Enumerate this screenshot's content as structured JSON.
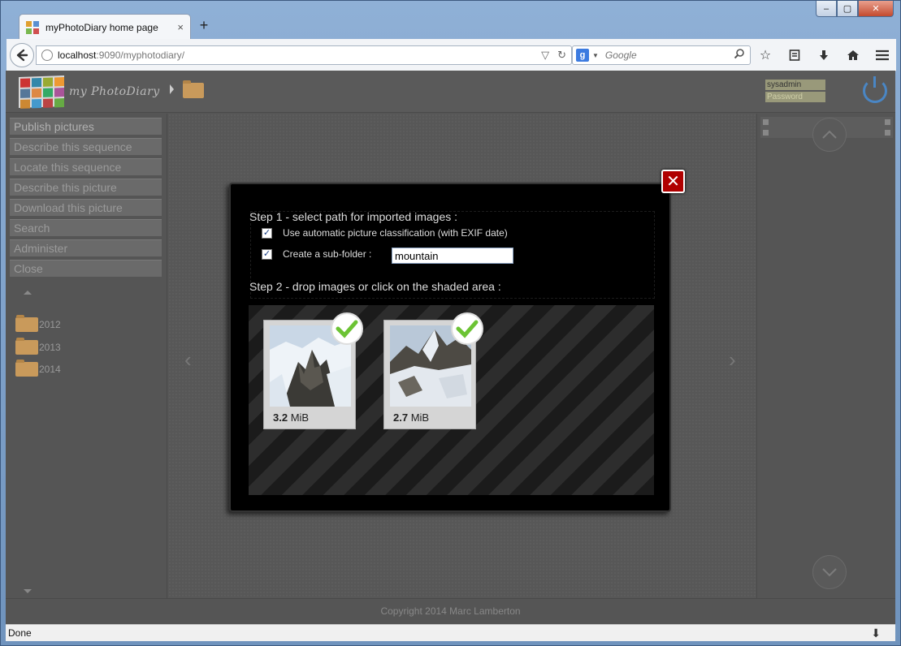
{
  "browser": {
    "tab_title": "myPhotoDiary home page",
    "tab_close": "×",
    "new_tab": "+",
    "url_host": "localhost",
    "url_path": ":9090/myphotodiary/",
    "search_engine_letter": "g",
    "search_placeholder": "Google",
    "status_text": "Done"
  },
  "app": {
    "logo_text": "my PhotoDiary",
    "login": {
      "username": "sysadmin",
      "password_placeholder": "Password"
    },
    "menu": [
      {
        "label": "Publish pictures"
      },
      {
        "label": "Describe this sequence"
      },
      {
        "label": "Locate this sequence"
      },
      {
        "label": "Describe this picture"
      },
      {
        "label": "Download this picture"
      },
      {
        "label": "Search"
      },
      {
        "label": "Administer"
      },
      {
        "label": "Close"
      }
    ],
    "tree": [
      {
        "year": "2012"
      },
      {
        "year": "2013"
      },
      {
        "year": "2014"
      }
    ],
    "footer": "Copyright 2014 Marc Lamberton"
  },
  "dialog": {
    "close_label": "✕",
    "step1_title": "Step 1 - select path for imported images :",
    "auto_class": {
      "label": "Use automatic picture classification (with EXIF date)",
      "checked": true
    },
    "subfolder": {
      "label": "Create a sub-folder :",
      "checked": true,
      "value": "mountain"
    },
    "step2_title": "Step 2 - drop images or click on the shaded area :",
    "uploads": [
      {
        "size_value": "3.2",
        "size_unit": "MiB",
        "status": "uploaded"
      },
      {
        "size_value": "2.7",
        "size_unit": "MiB",
        "status": "uploaded"
      }
    ]
  },
  "colors": {
    "dialog_close": "#b00000",
    "check_green": "#6cc334",
    "folder": "#c99a5b",
    "power": "#4a86c4"
  }
}
